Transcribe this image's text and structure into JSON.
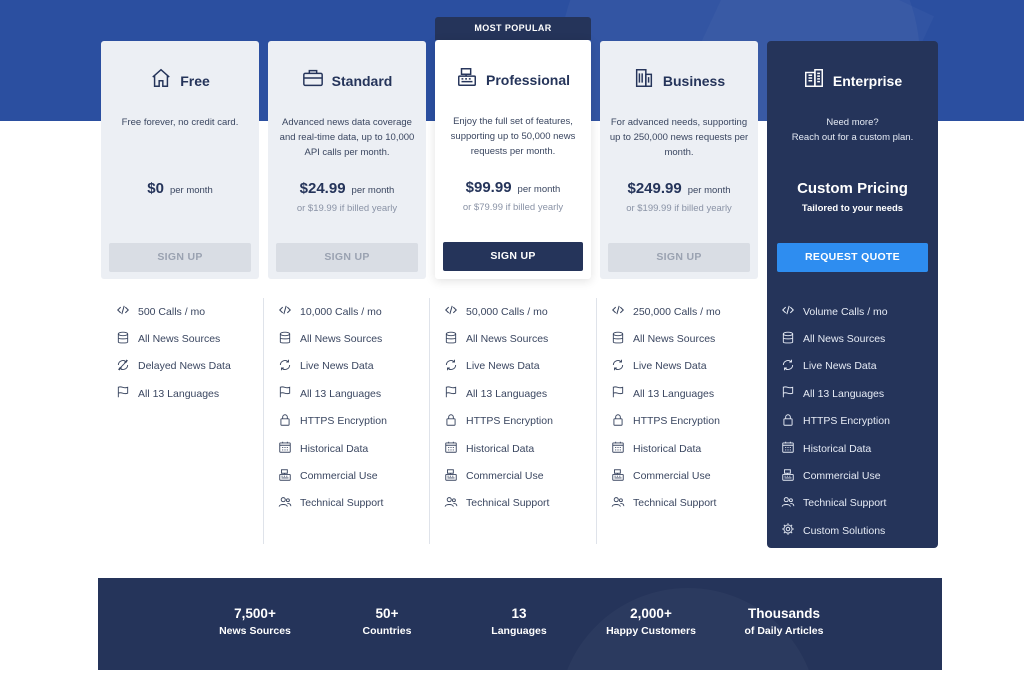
{
  "popular_badge": "MOST POPULAR",
  "plans": [
    {
      "name": "Free",
      "desc": "Free forever, no credit card.",
      "price": "$0",
      "per": "per month",
      "yearly": "",
      "button": "SIGN UP",
      "features": [
        "500 Calls / mo",
        "All News Sources",
        "Delayed News Data",
        "All 13 Languages"
      ]
    },
    {
      "name": "Standard",
      "desc": "Advanced news data coverage and real-time data, up to 10,000 API calls per month.",
      "price": "$24.99",
      "per": "per month",
      "yearly": "or $19.99 if billed yearly",
      "button": "SIGN UP",
      "features": [
        "10,000 Calls / mo",
        "All News Sources",
        "Live News Data",
        "All 13 Languages",
        "HTTPS Encryption",
        "Historical Data",
        "Commercial Use",
        "Technical Support"
      ]
    },
    {
      "name": "Professional",
      "desc": "Enjoy the full set of features, supporting up to 50,000 news requests per month.",
      "price": "$99.99",
      "per": "per month",
      "yearly": "or $79.99 if billed yearly",
      "button": "SIGN UP",
      "features": [
        "50,000 Calls / mo",
        "All News Sources",
        "Live News Data",
        "All 13 Languages",
        "HTTPS Encryption",
        "Historical Data",
        "Commercial Use",
        "Technical Support"
      ]
    },
    {
      "name": "Business",
      "desc": "For advanced needs, supporting up to 250,000 news requests per month.",
      "price": "$249.99",
      "per": "per month",
      "yearly": "or $199.99 if billed yearly",
      "button": "SIGN UP",
      "features": [
        "250,000 Calls / mo",
        "All News Sources",
        "Live News Data",
        "All 13 Languages",
        "HTTPS Encryption",
        "Historical Data",
        "Commercial Use",
        "Technical Support"
      ]
    },
    {
      "name": "Enterprise",
      "desc": "Need more?\nReach out for a custom plan.",
      "price": "Custom Pricing",
      "per": "Tailored to your needs",
      "yearly": "",
      "button": "REQUEST QUOTE",
      "features": [
        "Volume Calls / mo",
        "All News Sources",
        "Live News Data",
        "All 13 Languages",
        "HTTPS Encryption",
        "Historical Data",
        "Commercial Use",
        "Technical Support",
        "Custom Solutions"
      ]
    }
  ],
  "stats": [
    {
      "num": "7,500+",
      "label": "News Sources"
    },
    {
      "num": "50+",
      "label": "Countries"
    },
    {
      "num": "13",
      "label": "Languages"
    },
    {
      "num": "2,000+",
      "label": "Happy Customers"
    },
    {
      "num": "Thousands",
      "label": "of Daily Articles"
    }
  ],
  "colors": {
    "navy": "#25345a",
    "blue_band": "#2b4fa0",
    "accent": "#2e8df0"
  }
}
